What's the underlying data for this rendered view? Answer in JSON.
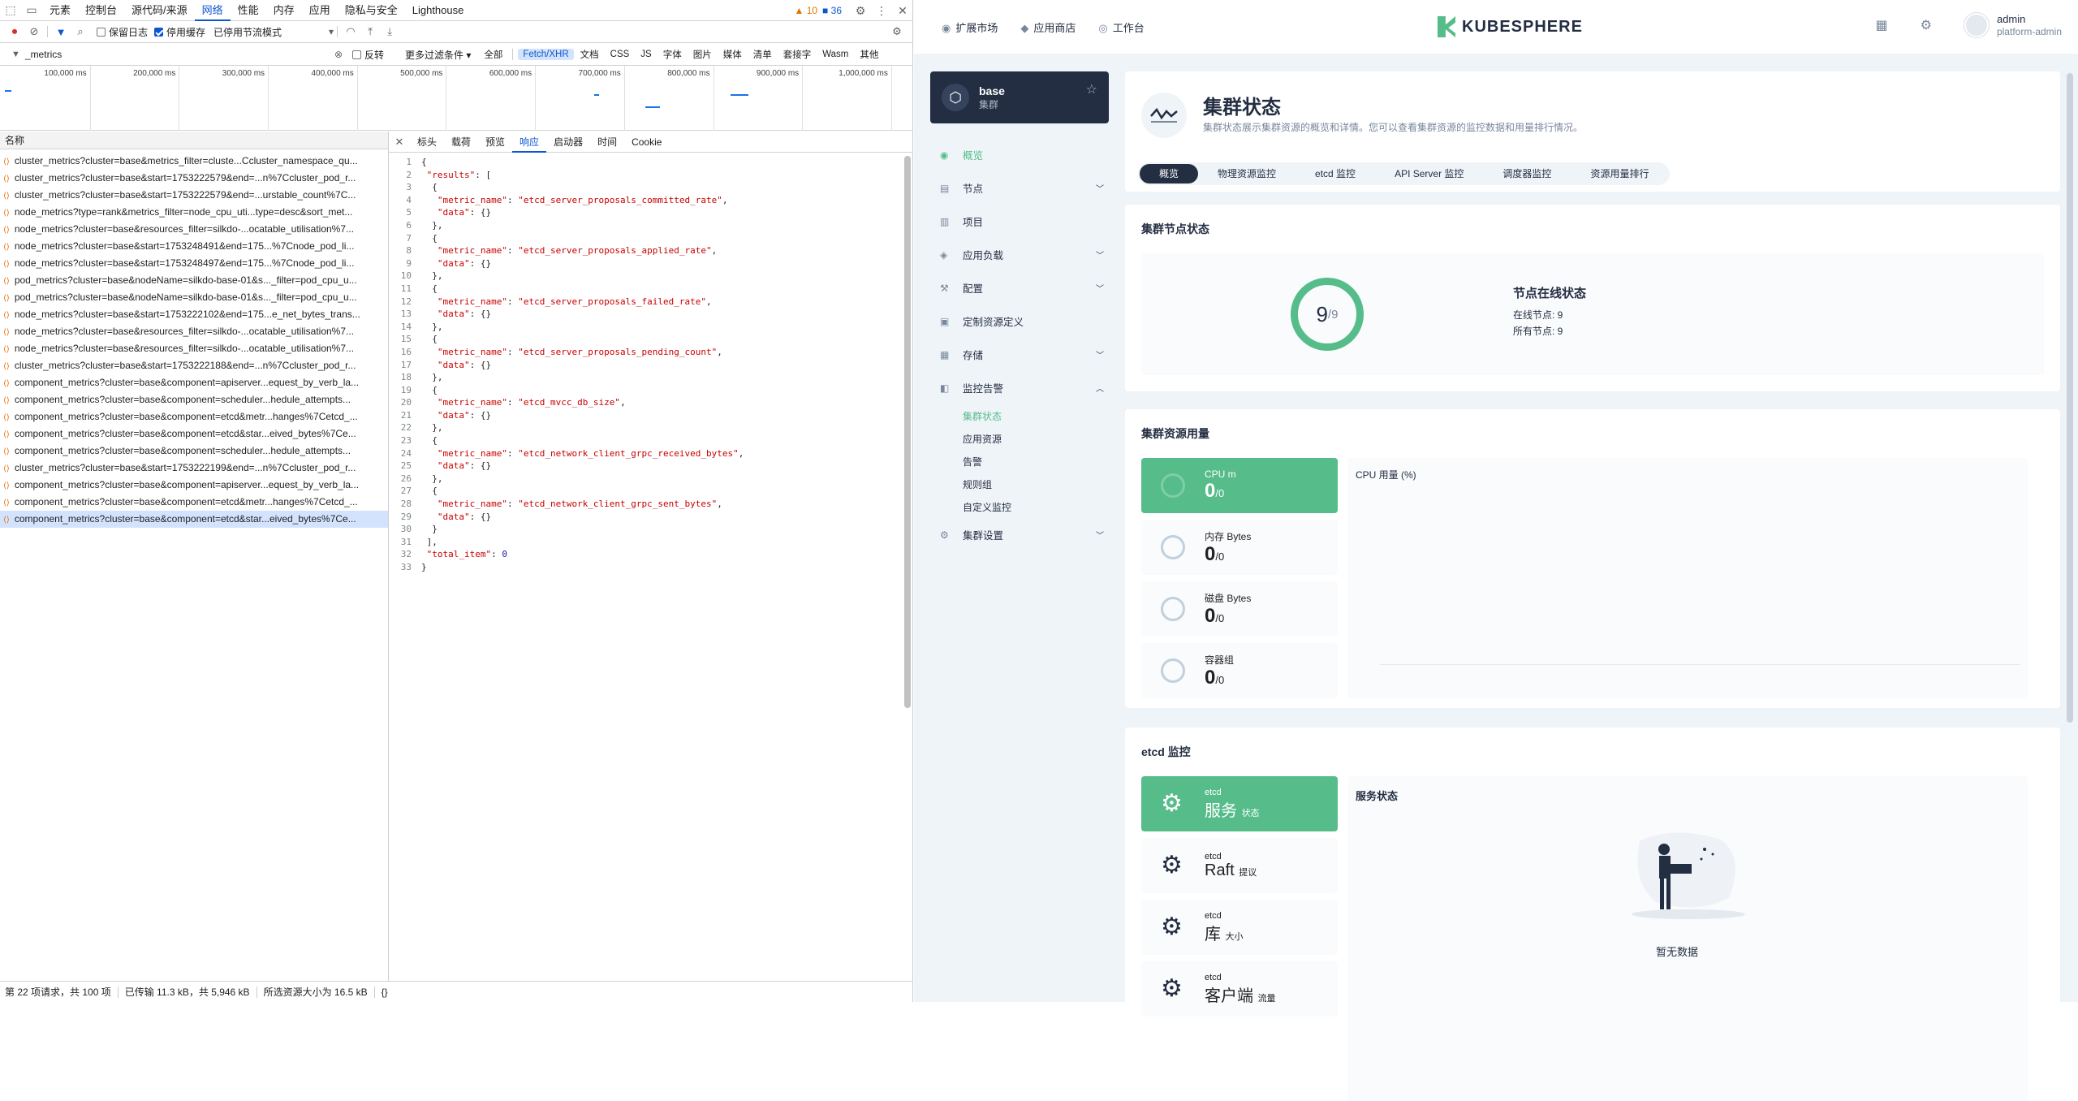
{
  "devtools": {
    "tabs": [
      "元素",
      "控制台",
      "源代码/来源",
      "网络",
      "性能",
      "内存",
      "应用",
      "隐私与安全",
      "Lighthouse"
    ],
    "active_tab": "网络",
    "warnings": "10",
    "errors": "36",
    "toolbar": {
      "preserve_log": "保留日志",
      "disable_cache": "停用缓存",
      "throttle": "已停用节流模式"
    },
    "filter": {
      "value": "_metrics",
      "invert": "反转",
      "more_filters": "更多过滤条件"
    },
    "type_chips": [
      "全部",
      "Fetch/XHR",
      "文档",
      "CSS",
      "JS",
      "字体",
      "图片",
      "媒体",
      "清单",
      "套接字",
      "Wasm",
      "其他"
    ],
    "active_chip": "Fetch/XHR",
    "timeline_ticks": [
      "100,000 ms",
      "200,000 ms",
      "300,000 ms",
      "400,000 ms",
      "500,000 ms",
      "600,000 ms",
      "700,000 ms",
      "800,000 ms",
      "900,000 ms",
      "1,000,000 ms"
    ],
    "name_header": "名称",
    "requests": [
      "cluster_metrics?cluster=base&metrics_filter=cluste...Ccluster_namespace_qu...",
      "cluster_metrics?cluster=base&start=1753222579&end=...n%7Ccluster_pod_r...",
      "cluster_metrics?cluster=base&start=1753222579&end=...urstable_count%7C...",
      "node_metrics?type=rank&metrics_filter=node_cpu_uti...type=desc&sort_met...",
      "node_metrics?cluster=base&resources_filter=silkdo-...ocatable_utilisation%7...",
      "node_metrics?cluster=base&start=1753248491&end=175...%7Cnode_pod_li...",
      "node_metrics?cluster=base&start=1753248497&end=175...%7Cnode_pod_li...",
      "pod_metrics?cluster=base&nodeName=silkdo-base-01&s..._filter=pod_cpu_u...",
      "pod_metrics?cluster=base&nodeName=silkdo-base-01&s..._filter=pod_cpu_u...",
      "node_metrics?cluster=base&start=1753222102&end=175...e_net_bytes_trans...",
      "node_metrics?cluster=base&resources_filter=silkdo-...ocatable_utilisation%7...",
      "node_metrics?cluster=base&resources_filter=silkdo-...ocatable_utilisation%7...",
      "cluster_metrics?cluster=base&start=1753222188&end=...n%7Ccluster_pod_r...",
      "component_metrics?cluster=base&component=apiserver...equest_by_verb_la...",
      "component_metrics?cluster=base&component=scheduler...hedule_attempts...",
      "component_metrics?cluster=base&component=etcd&metr...hanges%7Cetcd_...",
      "component_metrics?cluster=base&component=etcd&star...eived_bytes%7Ce...",
      "component_metrics?cluster=base&component=scheduler...hedule_attempts...",
      "cluster_metrics?cluster=base&start=1753222199&end=...n%7Ccluster_pod_r...",
      "component_metrics?cluster=base&component=apiserver...equest_by_verb_la...",
      "component_metrics?cluster=base&component=etcd&metr...hanges%7Cetcd_...",
      "component_metrics?cluster=base&component=etcd&star...eived_bytes%7Ce..."
    ],
    "detail_tabs": [
      "标头",
      "载荷",
      "预览",
      "响应",
      "启动器",
      "时间",
      "Cookie"
    ],
    "active_detail_tab": "响应",
    "metrics": [
      "etcd_server_proposals_committed_rate",
      "etcd_server_proposals_applied_rate",
      "etcd_server_proposals_failed_rate",
      "etcd_server_proposals_pending_count",
      "etcd_mvcc_db_size",
      "etcd_network_client_grpc_received_bytes",
      "etcd_network_client_grpc_sent_bytes"
    ],
    "total_item": "0",
    "status": {
      "requests": "第 22 项请求，共 100 项",
      "transferred": "已传输 11.3 kB，共 5,946 kB",
      "selected": "所选资源大小为 16.5 kB"
    }
  },
  "ks": {
    "nav": [
      "扩展市场",
      "应用商店",
      "工作台"
    ],
    "logo": "KUBESPHERE",
    "user": {
      "name": "admin",
      "role": "platform-admin"
    },
    "cluster": {
      "name": "base",
      "type": "集群"
    },
    "menu": [
      {
        "label": "概览",
        "active": true,
        "chev": false
      },
      {
        "label": "节点",
        "chev": true
      },
      {
        "label": "项目",
        "chev": false
      },
      {
        "label": "应用负载",
        "chev": true
      },
      {
        "label": "配置",
        "chev": true
      },
      {
        "label": "定制资源定义",
        "chev": false
      },
      {
        "label": "存储",
        "chev": true
      },
      {
        "label": "监控告警",
        "chev": true,
        "open": true
      }
    ],
    "submenu": [
      "集群状态",
      "应用资源",
      "告警",
      "规则组",
      "自定义监控"
    ],
    "settings": "集群设置",
    "page": {
      "title": "集群状态",
      "desc": "集群状态展示集群资源的概览和详情。您可以查看集群资源的监控数据和用量排行情况。"
    },
    "subtabs": [
      "概览",
      "物理资源监控",
      "etcd 监控",
      "API Server 监控",
      "调度器监控",
      "资源用量排行"
    ],
    "nodes": {
      "title": "集群节点状态",
      "online": "9",
      "total": "9",
      "status_title": "节点在线状态",
      "online_label": "在线节点: 9",
      "all_label": "所有节点: 9"
    },
    "resources": {
      "title": "集群资源用量",
      "chart_title": "CPU 用量 (%)",
      "items": [
        {
          "label": "CPU m",
          "value": "0",
          "total": "/0"
        },
        {
          "label": "内存 Bytes",
          "value": "0",
          "total": "/0"
        },
        {
          "label": "磁盘 Bytes",
          "value": "0",
          "total": "/0"
        },
        {
          "label": "容器组",
          "value": "0",
          "total": "/0"
        }
      ]
    },
    "etcd": {
      "title": "etcd 监控",
      "service_status": "服务状态",
      "no_data": "暂无数据",
      "items": [
        {
          "top": "etcd",
          "main": "服务",
          "sub": "状态"
        },
        {
          "top": "etcd",
          "main": "Raft",
          "sub": "提议"
        },
        {
          "top": "etcd",
          "main": "库",
          "sub": "大小"
        },
        {
          "top": "etcd",
          "main": "客户端",
          "sub": "流量"
        }
      ]
    }
  }
}
